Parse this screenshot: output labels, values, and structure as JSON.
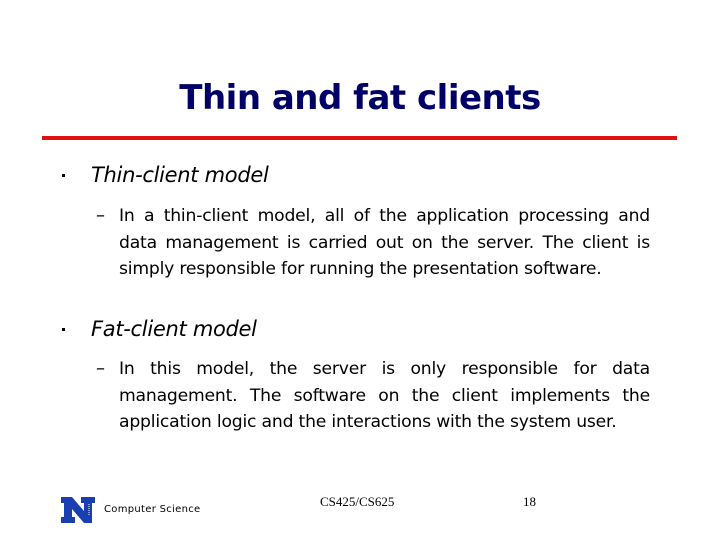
{
  "slide": {
    "title": "Thin and fat clients",
    "accent_rule_color": "#e01010",
    "title_color": "#000066"
  },
  "bullets": [
    {
      "label": "Thin-client model",
      "sub": [
        {
          "marker": "–",
          "text": "In a thin-client model, all of the application processing and data management is carried out on the server. The client is simply responsible for running the presentation software."
        }
      ]
    },
    {
      "label": "Fat-client model",
      "sub": [
        {
          "marker": "–",
          "text": "In this model, the server is only responsible for data management. The software on the client implements the application logic and the interactions with the system user."
        }
      ]
    }
  ],
  "footer": {
    "logo": "university-n-logo",
    "logo_color": "#1a3fb0",
    "department": "Computer Science",
    "course": "CS425/CS625",
    "page_number": "18"
  }
}
